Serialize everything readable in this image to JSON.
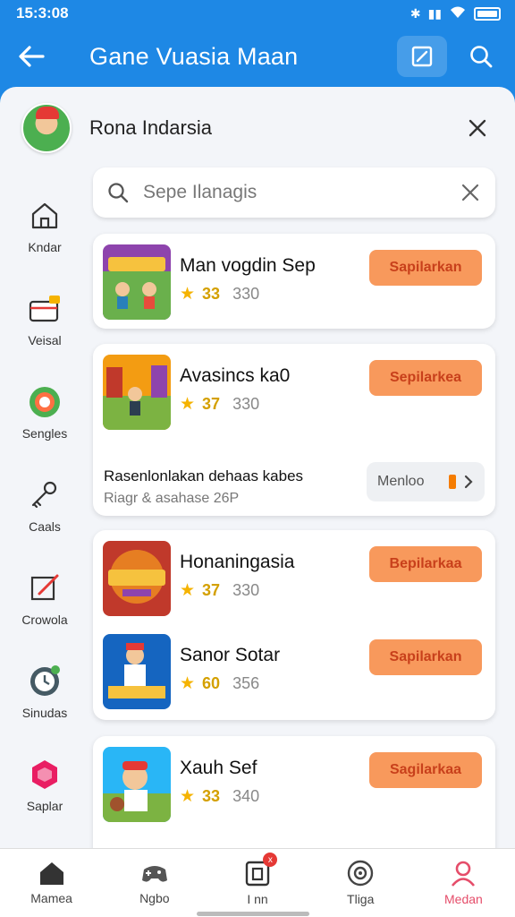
{
  "status_bar": {
    "time": "15:3:08"
  },
  "header": {
    "title": "Gane Vuasia Maan"
  },
  "profile": {
    "name": "Rona Indarsia"
  },
  "search": {
    "placeholder": "Sepe Ilanagis"
  },
  "side_nav": [
    {
      "label": "Kndar",
      "icon": "home-outline-icon"
    },
    {
      "label": "Veisal",
      "icon": "wallet-icon"
    },
    {
      "label": "Sengles",
      "icon": "target-icon"
    },
    {
      "label": "Caals",
      "icon": "key-icon"
    },
    {
      "label": "Crowola",
      "icon": "edit-icon"
    },
    {
      "label": "Sinudas",
      "icon": "clock-icon"
    },
    {
      "label": "Saplar",
      "icon": "cube-icon"
    }
  ],
  "games": [
    {
      "name": "Man vogdin Sep",
      "score": "33",
      "count": "330",
      "button": "Sapilarkan"
    },
    {
      "name": "Avasincs ka0",
      "score": "37",
      "count": "330",
      "button": "Sepilarkea"
    },
    {
      "name": "Honaningasia",
      "score": "37",
      "count": "330",
      "button": "Bepilarkaa"
    },
    {
      "name": "Sanor Sotar",
      "score": "60",
      "count": "356",
      "button": "Sapilarkan"
    },
    {
      "name": "Xauh Sef",
      "score": "33",
      "count": "340",
      "button": "Sagilarkaa"
    }
  ],
  "promo": {
    "line1": "Rasenlonlakan dehaas kabes",
    "line2": "Riagr & asahase 26P",
    "button": "Menloo"
  },
  "bottom_nav": [
    {
      "label": "Mamea",
      "icon": "home-icon",
      "active": false
    },
    {
      "label": "Ngbo",
      "icon": "gamepad-icon",
      "active": false
    },
    {
      "label": "I nn",
      "icon": "inbox-icon",
      "active": false,
      "badge": "x"
    },
    {
      "label": "Tliga",
      "icon": "disc-icon",
      "active": false
    },
    {
      "label": "Medan",
      "icon": "person-icon",
      "active": true
    }
  ],
  "colors": {
    "primary": "#1e88e5",
    "accent": "#f8995c",
    "active_tab": "#e54d6a",
    "star": "#f5b301"
  }
}
